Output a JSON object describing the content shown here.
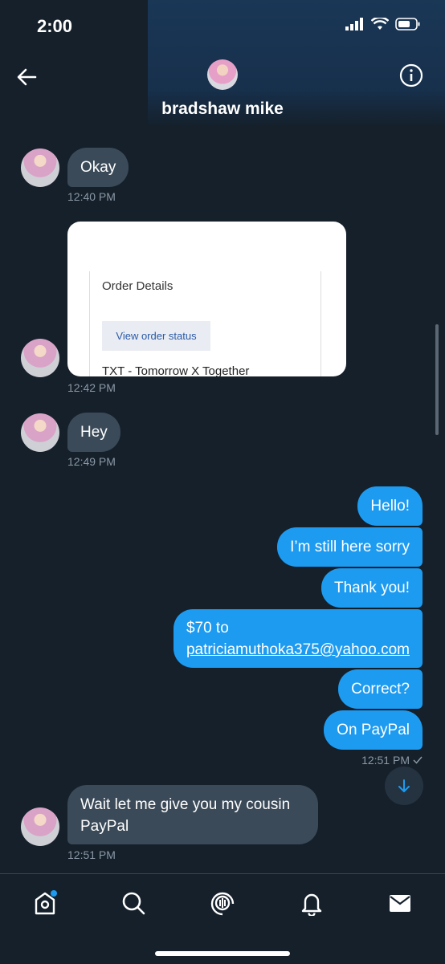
{
  "status": {
    "time": "2:00"
  },
  "header": {
    "name": "bradshaw mike"
  },
  "messages_in": [
    {
      "text": "Okay",
      "time": "12:40 PM"
    },
    {
      "time": "12:42 PM"
    },
    {
      "text": "Hey",
      "time": "12:49 PM"
    },
    {
      "text": "Wait let me give you my cousin PayPal",
      "time": "12:51 PM"
    }
  ],
  "card": {
    "title": "Order Details",
    "button": "View order status",
    "item": "TXT - Tomorrow X Together"
  },
  "messages_out": [
    {
      "text": "Hello!"
    },
    {
      "text": "I’m still here sorry"
    },
    {
      "text": "Thank you!"
    },
    {
      "line1": "$70 to",
      "link": "patriciamuthoka375@yahoo.com"
    },
    {
      "text": "Correct?"
    },
    {
      "text": "On PayPal"
    }
  ],
  "sent_time": "12:51 PM",
  "nav": [
    "home-icon",
    "search-icon",
    "spaces-icon",
    "notifications-icon",
    "messages-icon"
  ]
}
